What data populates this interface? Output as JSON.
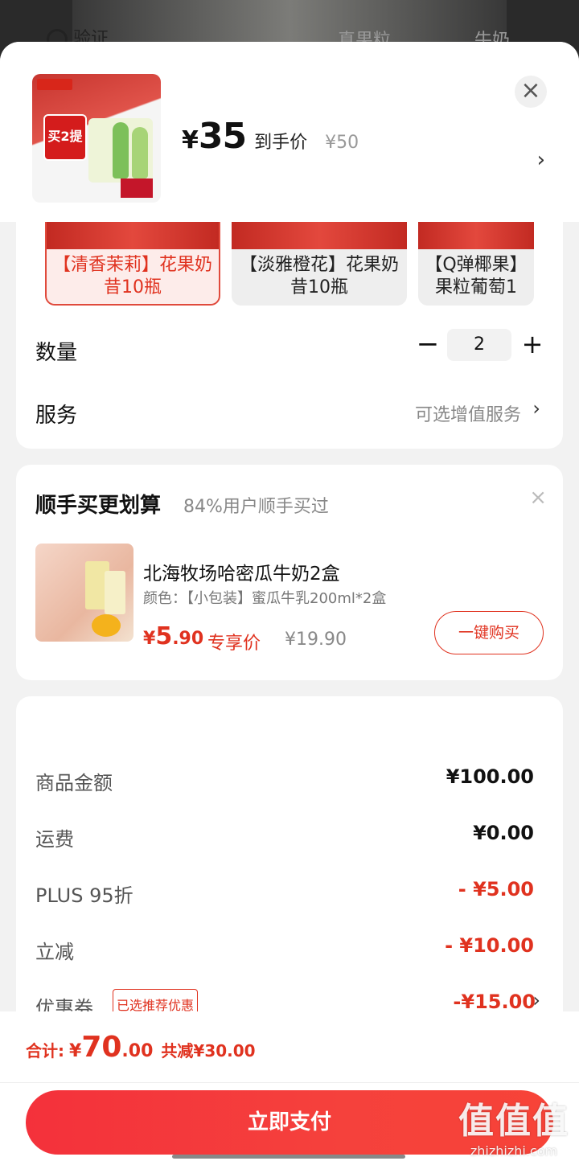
{
  "background": {
    "search_fragment": "验证",
    "tab_fragments": [
      "真果粒",
      "牛奶"
    ]
  },
  "header": {
    "currency": "¥",
    "price": "35",
    "price_tag": "到手价",
    "original_price": "¥50",
    "close_glyph": "×",
    "selector_chevron": "›",
    "thumb_badge": "买2提"
  },
  "specs": {
    "options": [
      {
        "label": "【清香茉莉】花果奶昔10瓶",
        "selected": true
      },
      {
        "label": "【淡雅橙花】花果奶昔10瓶",
        "selected": false
      },
      {
        "label": "【Q弹椰果】果粒葡萄1",
        "selected": false
      }
    ],
    "quantity_label": "数量",
    "quantity_value": "2",
    "minus_glyph": "−",
    "plus_glyph": "+",
    "service_label": "服务",
    "service_hint": "可选增值服务",
    "service_chevron": "›"
  },
  "upsell": {
    "title": "顺手买更划算",
    "subtitle": "84%用户顺手买过",
    "close_glyph": "×",
    "product_name": "北海牧场哈密瓜牛奶2盒",
    "product_spec": "颜色：【小包装】蜜瓜牛乳200ml*2盒",
    "price_symbol": "¥",
    "price_int": "5",
    "price_dec": ".90",
    "price_tag": "专享价",
    "original_price": "¥19.90",
    "buy_label": "一键购买"
  },
  "summary": {
    "rows": [
      {
        "label": "商品金额",
        "value": "¥100.00"
      },
      {
        "label": "运费",
        "value": "¥0.00"
      },
      {
        "label": "PLUS 95折",
        "value": "- ¥5.00"
      },
      {
        "label": "立减",
        "value": "- ¥10.00"
      },
      {
        "label": "优惠券",
        "value": "-¥15.00"
      }
    ],
    "coupon_badge": "已选推荐优惠",
    "coupon_chevron": "›"
  },
  "footer": {
    "total_label": "合计:",
    "total_symbol": "¥",
    "total_int": "70",
    "total_dec": ".00",
    "total_saving": "共减¥30.00",
    "pay_label": "立即支付"
  },
  "watermark": {
    "brand": "值值值",
    "domain": "zhizhizhi.com"
  },
  "colors": {
    "accent_red": "#e0321f",
    "pay_button": "#f5413c"
  }
}
